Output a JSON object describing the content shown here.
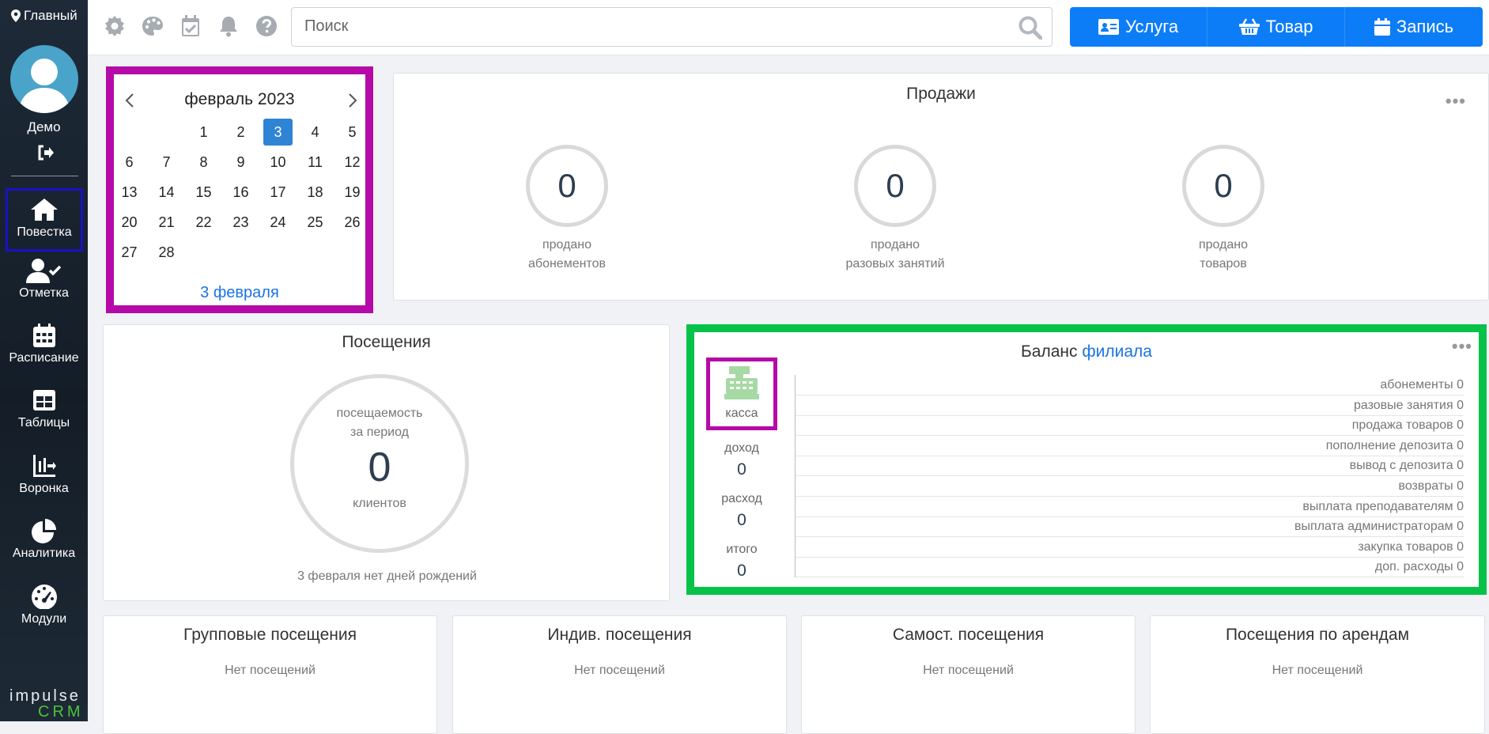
{
  "sidebar": {
    "location": "Главный",
    "user_name": "Демо",
    "nav": [
      {
        "label": "Повестка",
        "icon": "home-icon"
      },
      {
        "label": "Отметка",
        "icon": "user-check-icon"
      },
      {
        "label": "Расписание",
        "icon": "calendar-icon"
      },
      {
        "label": "Таблицы",
        "icon": "table-icon"
      },
      {
        "label": "Воронка",
        "icon": "funnel-chart-icon"
      },
      {
        "label": "Аналитика",
        "icon": "pie-chart-icon"
      },
      {
        "label": "Модули",
        "icon": "gauge-icon"
      }
    ],
    "logo_top": "impulse",
    "logo_bottom": "CRM"
  },
  "topbar": {
    "search_placeholder": "Поиск",
    "actions": [
      "Услуга",
      "Товар",
      "Запись"
    ]
  },
  "calendar": {
    "month": "февраль 2023",
    "days": [
      "",
      "",
      "1",
      "2",
      "3",
      "4",
      "5",
      "6",
      "7",
      "8",
      "9",
      "10",
      "11",
      "12",
      "13",
      "14",
      "15",
      "16",
      "17",
      "18",
      "19",
      "20",
      "21",
      "22",
      "23",
      "24",
      "25",
      "26",
      "27",
      "28"
    ],
    "selected": "3",
    "today_link": "3 февраля"
  },
  "sales": {
    "title": "Продажи",
    "items": [
      {
        "value": "0",
        "line1": "продано",
        "line2": "абонементов"
      },
      {
        "value": "0",
        "line1": "продано",
        "line2": "разовых занятий"
      },
      {
        "value": "0",
        "line1": "продано",
        "line2": "товаров"
      }
    ]
  },
  "visits": {
    "title": "Посещения",
    "line1": "посещаемость",
    "line2": "за период",
    "value": "0",
    "unit": "клиентов",
    "birthdays": "3 февраля нет дней рождений"
  },
  "balance": {
    "title": "Баланс",
    "title_link": "филиала",
    "kassa": "касса",
    "income_label": "доход",
    "income": "0",
    "expense_label": "расход",
    "expense": "0",
    "total_label": "итого",
    "total": "0",
    "rows": [
      "абонементы 0",
      "разовые занятия 0",
      "продажа товаров 0",
      "пополнение депозита 0",
      "вывод с депозита 0",
      "возвраты 0",
      "выплата преподавателям 0",
      "выплата администраторам 0",
      "закупка товаров 0",
      "доп. расходы 0"
    ]
  },
  "bottom_panels": [
    {
      "title": "Групповые посещения",
      "msg": "Нет посещений"
    },
    {
      "title": "Индив. посещения",
      "msg": "Нет посещений"
    },
    {
      "title": "Самост. посещения",
      "msg": "Нет посещений"
    },
    {
      "title": "Посещения по арендам",
      "msg": "Нет посещений"
    }
  ],
  "colors": {
    "accent": "#0d7df7",
    "highlight_magenta": "#b50aa7",
    "highlight_green": "#06c248",
    "active_nav": "#1a10c7"
  }
}
